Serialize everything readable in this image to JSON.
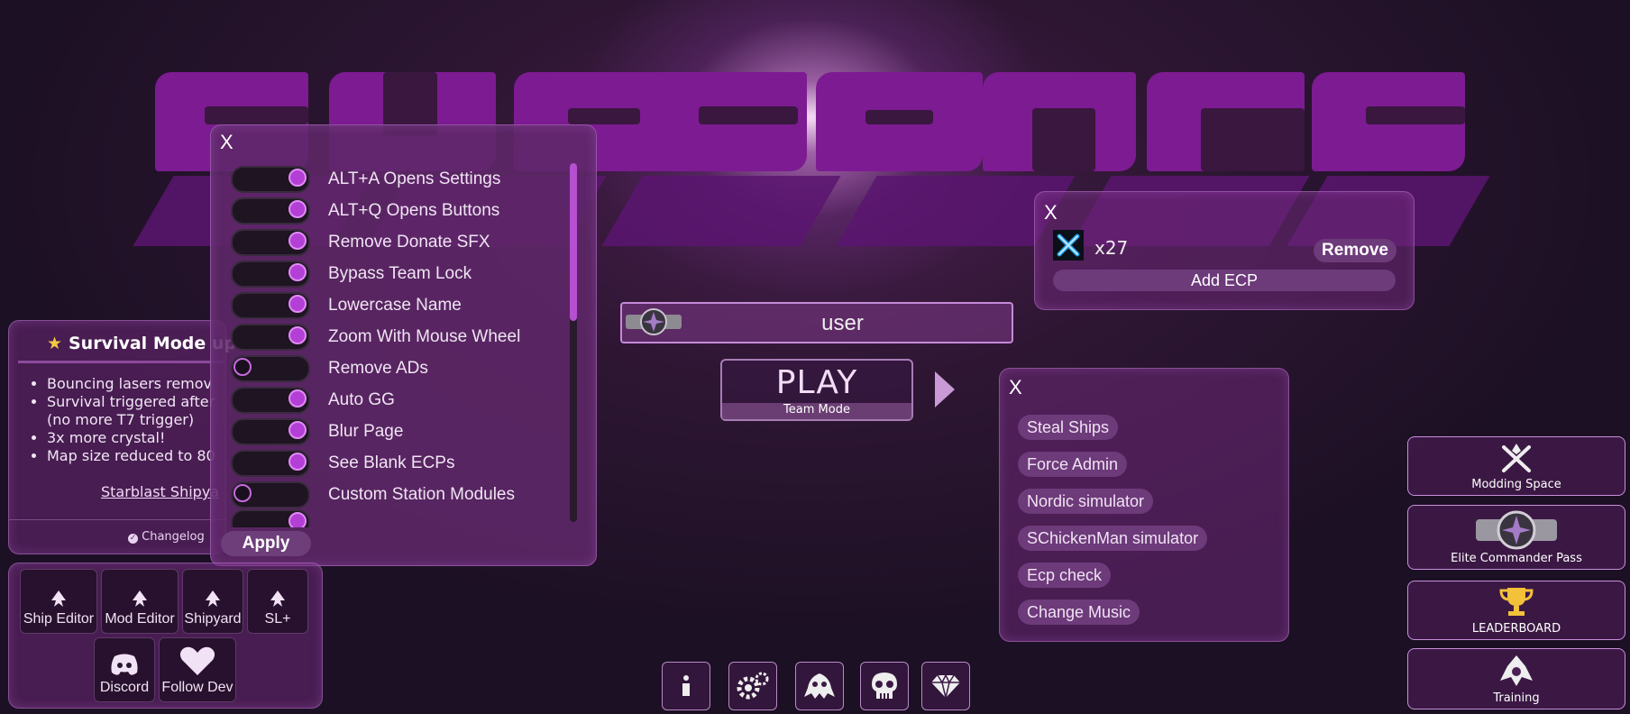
{
  "settings": {
    "close": "X",
    "apply": "Apply",
    "items": [
      {
        "label": "ALT+A Opens Settings",
        "on": true
      },
      {
        "label": "ALT+Q Opens Buttons",
        "on": true
      },
      {
        "label": "Remove Donate SFX",
        "on": true
      },
      {
        "label": "Bypass Team Lock",
        "on": true
      },
      {
        "label": "Lowercase Name",
        "on": true
      },
      {
        "label": "Zoom With Mouse Wheel",
        "on": true
      },
      {
        "label": "Remove ADs",
        "on": false
      },
      {
        "label": "Auto GG",
        "on": true
      },
      {
        "label": "Blur Page",
        "on": true
      },
      {
        "label": "See Blank ECPs",
        "on": true
      },
      {
        "label": "Custom Station Modules",
        "on": false
      }
    ]
  },
  "news": {
    "title": "Survival Mode up",
    "bullets": [
      "Bouncing lasers remov",
      "Survival triggered after",
      "(no more T7 trigger)",
      "3x more crystal!",
      "Map size reduced to 80"
    ],
    "link": "Starblast Shipya",
    "changelog": "Changelog"
  },
  "tools": {
    "ship_editor": "Ship Editor",
    "mod_editor": "Mod Editor",
    "shipyard": "Shipyard",
    "sl_plus": "SL+",
    "discord": "Discord",
    "follow_dev": "Follow Dev"
  },
  "user": {
    "name": "user"
  },
  "play": {
    "label": "PLAY",
    "mode": "Team Mode"
  },
  "ecp": {
    "close": "X",
    "count": "x27",
    "remove": "Remove",
    "add": "Add ECP"
  },
  "hacks": {
    "close": "X",
    "items": [
      "Steal Ships",
      "Force Admin",
      "Nordic simulator",
      "SChickenMan simulator",
      "Ecp check",
      "Change Music"
    ]
  },
  "right": {
    "modding": "Modding Space",
    "ecp_pass": "Elite Commander Pass",
    "leaderboard": "LEADERBOARD",
    "training": "Training"
  },
  "colors": {
    "accent": "#b43fd6",
    "logo": "#7d1b92"
  }
}
